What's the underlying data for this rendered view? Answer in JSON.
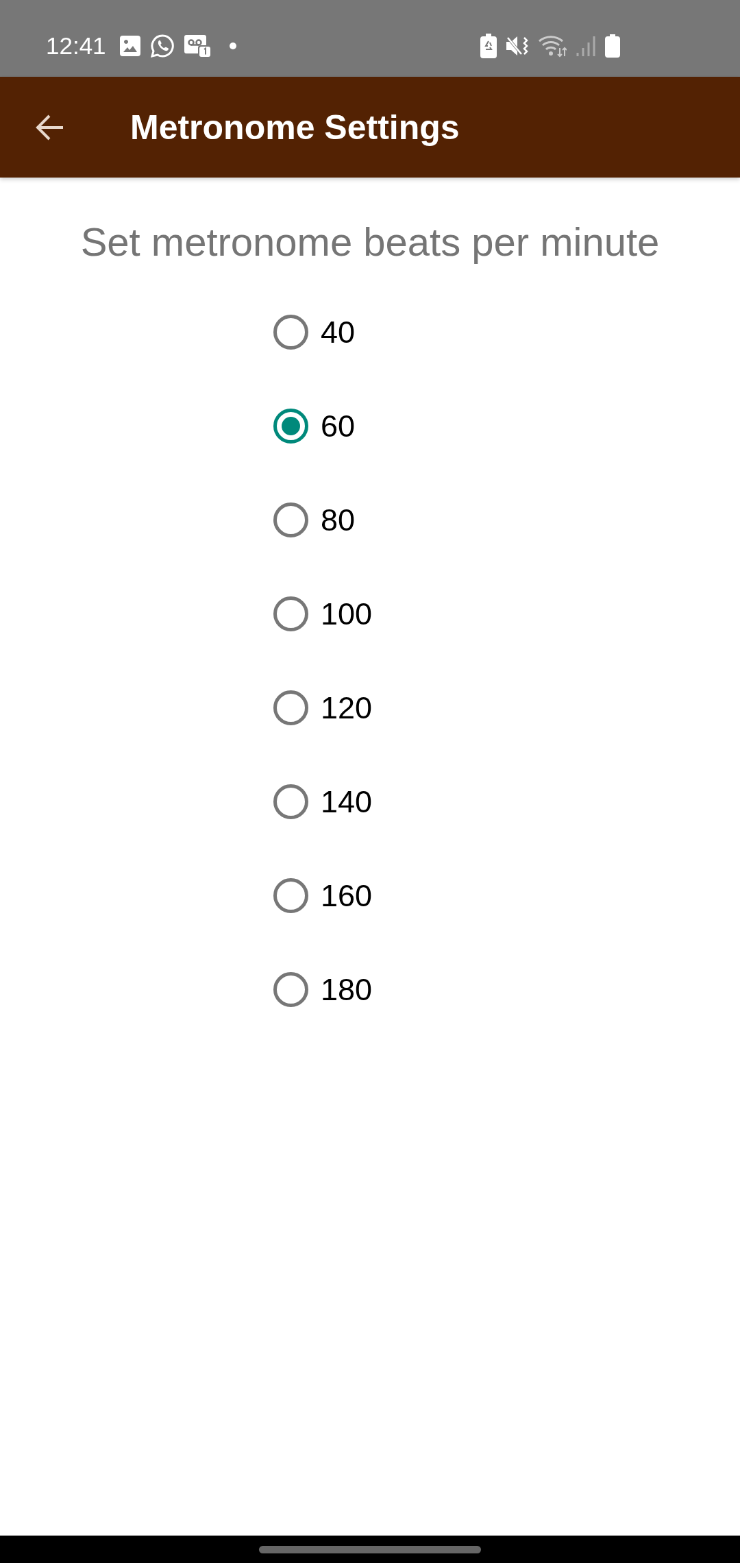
{
  "status_bar": {
    "time": "12:41"
  },
  "app_bar": {
    "title": "Metronome Settings"
  },
  "heading": "Set metronome beats per minute",
  "options": [
    {
      "label": "40",
      "selected": false
    },
    {
      "label": "60",
      "selected": true
    },
    {
      "label": "80",
      "selected": false
    },
    {
      "label": "100",
      "selected": false
    },
    {
      "label": "120",
      "selected": false
    },
    {
      "label": "140",
      "selected": false
    },
    {
      "label": "160",
      "selected": false
    },
    {
      "label": "180",
      "selected": false
    }
  ]
}
